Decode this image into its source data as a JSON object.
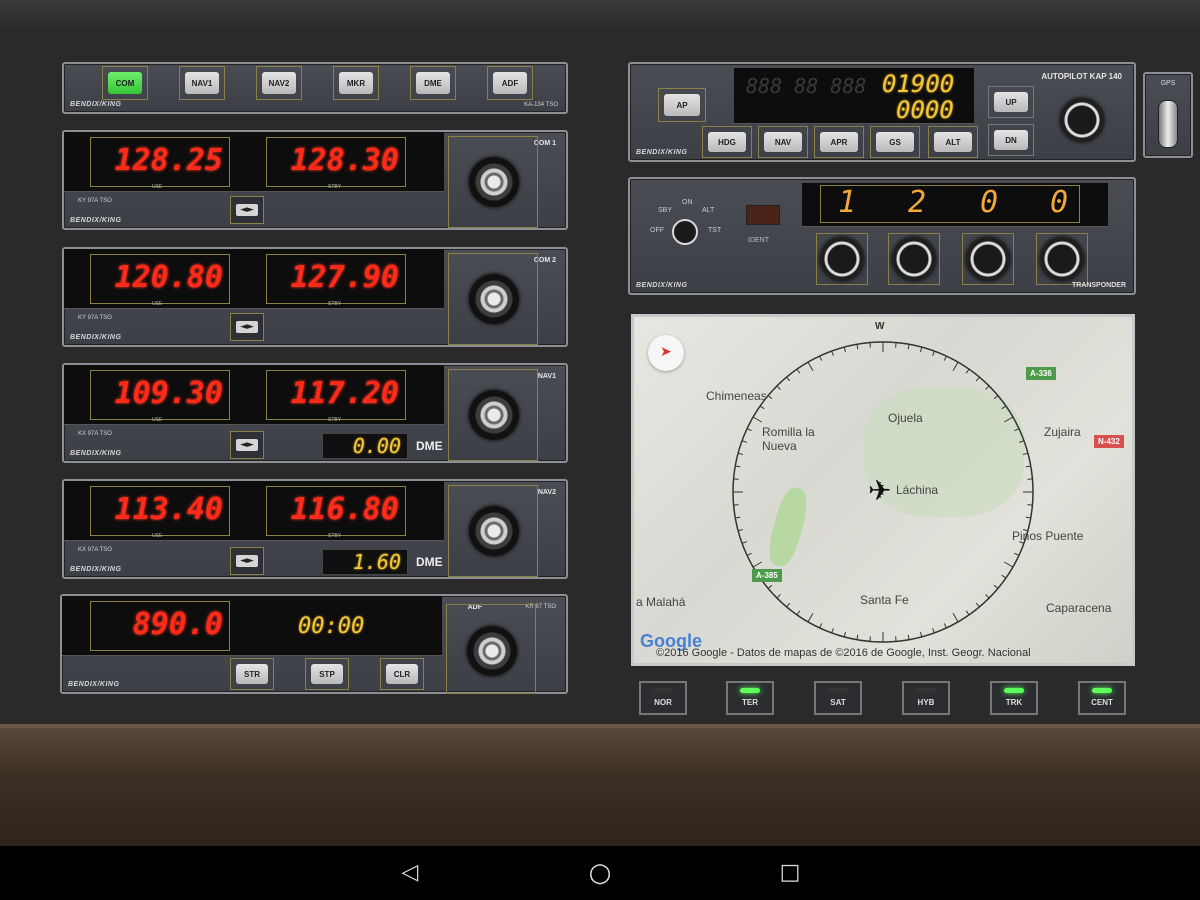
{
  "audio_panel": {
    "buttons": [
      {
        "label": "COM",
        "active": true
      },
      {
        "label": "NAV1",
        "active": false
      },
      {
        "label": "NAV2",
        "active": false
      },
      {
        "label": "MKR",
        "active": false
      },
      {
        "label": "DME",
        "active": false
      },
      {
        "label": "ADF",
        "active": false
      }
    ],
    "brand": "BENDIX/KING",
    "model": "KA-134 TSO"
  },
  "com1": {
    "name": "COM 1",
    "active": "128.25",
    "standby": "128.30",
    "use": "USE",
    "stby": "STBY",
    "model": "KY 97A TSO",
    "brand": "BENDIX/KING",
    "flip": "◄►"
  },
  "com2": {
    "name": "COM 2",
    "active": "120.80",
    "standby": "127.90",
    "use": "USE",
    "stby": "STBY",
    "model": "KY 97A TSO",
    "brand": "BENDIX/KING",
    "flip": "◄►"
  },
  "nav1": {
    "name": "NAV1",
    "active": "109.30",
    "standby": "117.20",
    "use": "USE",
    "stby": "STBY",
    "model": "KX 97A TSO",
    "brand": "BENDIX/KING",
    "flip": "◄►",
    "dme": "0.00",
    "dme_label": "DME"
  },
  "nav2": {
    "name": "NAV2",
    "active": "113.40",
    "standby": "116.80",
    "use": "USE",
    "stby": "STBY",
    "model": "KX 97A TSO",
    "brand": "BENDIX/KING",
    "flip": "◄►",
    "dme": "1.60",
    "dme_label": "DME"
  },
  "adf": {
    "name": "ADF",
    "model": "KR 87 TSO",
    "freq": "890.0",
    "timer": "00:00",
    "brand": "BENDIX/KING",
    "buttons": [
      "STR",
      "STP",
      "CLR"
    ]
  },
  "autopilot": {
    "title": "AUTOPILOT KAP 140",
    "altitude": "01900",
    "vs": "0000",
    "ap": "AP",
    "up": "UP",
    "dn": "DN",
    "modes": [
      "HDG",
      "NAV",
      "APR",
      "GS",
      "ALT"
    ],
    "brand": "BENDIX/KING"
  },
  "gps": {
    "label": "GPS"
  },
  "transponder": {
    "code": [
      "1",
      "2",
      "0",
      "0"
    ],
    "modes": [
      "OFF",
      "SBY",
      "ON",
      "ALT",
      "TST"
    ],
    "ident": "IDENT",
    "name": "TRANSPONDER",
    "brand": "BENDIX/KING"
  },
  "map": {
    "towns": [
      "Chimeneas",
      "Ojuela",
      "Romilla la Nueva",
      "Zujaira",
      "Láchina",
      "Pinos Puente",
      "Santa Fe",
      "Caparacena",
      "a Malahá"
    ],
    "road_badges": [
      "A-336",
      "N-432",
      "A-385"
    ],
    "compass_north": "W",
    "provider_logo": "Google",
    "attribution": "©2016 Google - Datos de mapas de ©2016 de Google, Inst. Geogr. Nacional"
  },
  "map_modes": [
    {
      "label": "NOR",
      "active": false
    },
    {
      "label": "TER",
      "active": true
    },
    {
      "label": "SAT",
      "active": false
    },
    {
      "label": "HYB",
      "active": false
    },
    {
      "label": "TRK",
      "active": true
    },
    {
      "label": "CENT",
      "active": true
    }
  ],
  "system_nav": {
    "back": "◁",
    "home": "○",
    "recents": "□"
  }
}
